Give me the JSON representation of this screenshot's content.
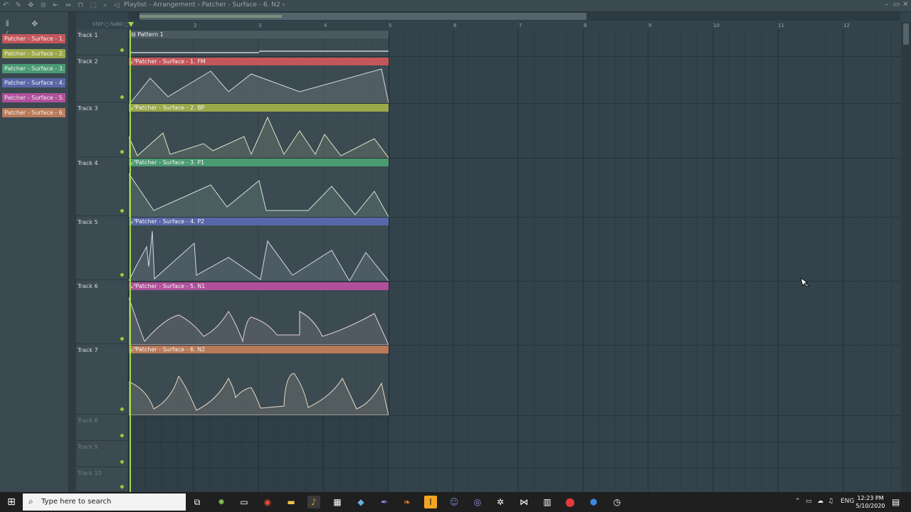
{
  "titlebar": {
    "title": "Playlist - Arrangement › Patcher - Surface - 6. N2 ›",
    "minimize": "–",
    "maximize": "▭",
    "close": "✕"
  },
  "toolbar": {
    "step_label": "STEP",
    "snap_label": "SUBD"
  },
  "patterns": [
    {
      "label": "Patcher - Surface - 1. FM",
      "color": "#c2565b"
    },
    {
      "label": "Patcher - Surface - 2. BP",
      "color": "#9aa84a"
    },
    {
      "label": "Patcher - Surface - 3. P1",
      "color": "#4a9a72"
    },
    {
      "label": "Patcher - Surface - 4. P2",
      "color": "#5867a8"
    },
    {
      "label": "Patcher - Surface - 5. N1",
      "color": "#b0509a"
    },
    {
      "label": "Patcher - Surface - 6. N2",
      "color": "#b87a58"
    }
  ],
  "ruler": [
    "2",
    "3",
    "4",
    "5",
    "6",
    "7",
    "8",
    "9",
    "10",
    "11",
    "12"
  ],
  "tracks": [
    {
      "name": "Track 1"
    },
    {
      "name": "Track 2"
    },
    {
      "name": "Track 3"
    },
    {
      "name": "Track 4"
    },
    {
      "name": "Track 5"
    },
    {
      "name": "Track 6"
    },
    {
      "name": "Track 7"
    },
    {
      "name": "Track 8"
    },
    {
      "name": "Track 9"
    },
    {
      "name": "Track 10"
    }
  ],
  "clips": [
    {
      "label": "Pattern 1",
      "color": "#4b5a61"
    },
    {
      "label": "Patcher - Surface - 1. FM",
      "color": "#c2565b"
    },
    {
      "label": "Patcher - Surface - 2. BP",
      "color": "#9aa84a"
    },
    {
      "label": "Patcher - Surface - 3. P1",
      "color": "#4a9a72"
    },
    {
      "label": "Patcher - Surface - 4. P2",
      "color": "#5867a8"
    },
    {
      "label": "Patcher - Surface - 5. N1",
      "color": "#b0509a"
    },
    {
      "label": "Patcher - Surface - 6. N2",
      "color": "#b87a58"
    }
  ],
  "taskbar": {
    "search_placeholder": "Type here to search",
    "language": "ENG",
    "time": "12:23 PM",
    "date": "5/10/2020"
  }
}
